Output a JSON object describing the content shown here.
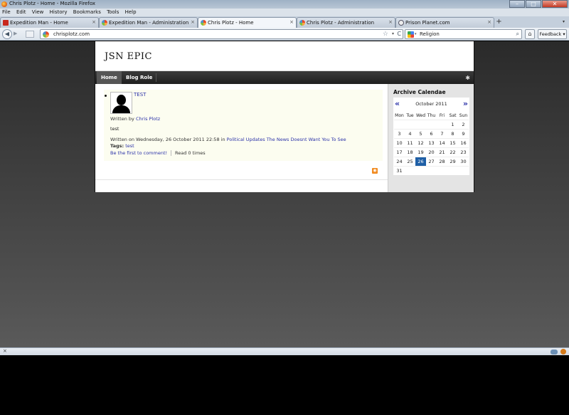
{
  "window": {
    "title": "Chris Plotz - Home - Mozilla Firefox",
    "controls": {
      "minimize": "–",
      "maximize": "□",
      "close": "✕"
    }
  },
  "menu": [
    "File",
    "Edit",
    "View",
    "History",
    "Bookmarks",
    "Tools",
    "Help"
  ],
  "tabs": [
    {
      "label": "Expedition Man - Home",
      "favicon": "red-square-icon"
    },
    {
      "label": "Expedition Man - Administration",
      "favicon": "joomla-icon"
    },
    {
      "label": "Chris Plotz - Home",
      "favicon": "site-icon",
      "active": true
    },
    {
      "label": "Chris Plotz - Administration",
      "favicon": "joomla-icon"
    },
    {
      "label": "Prison Planet.com",
      "favicon": "globe-icon"
    }
  ],
  "tab_close_glyph": "×",
  "new_tab_glyph": "+",
  "tab_list_glyph": "▾",
  "nav": {
    "url": "chrisplotz.com",
    "search_query": "Religion",
    "feedback_label": "Feedback",
    "back_glyph": "◀",
    "forward_glyph": "▶",
    "star_glyph": "☆",
    "dropdown_glyph": "▾",
    "reload_glyph": "C",
    "search_glyph": "⌕",
    "home_glyph": "⌂"
  },
  "site": {
    "logo": "JSN EPIC",
    "menu": [
      "Home",
      "Blog Role"
    ],
    "settings_glyph": "✱"
  },
  "article": {
    "title": "TEST",
    "written_by_prefix": "Written by",
    "author": "Chris Plotz",
    "body": "test",
    "meta_prefix": "Written on Wednesday, 26 October 2011 22:58 in",
    "category": "Political Updates The News Doesnt Want You To See",
    "tags_label": "Tags:",
    "tag": "test",
    "comment_link": "Be the first to comment!",
    "read_times": "Read 0 times",
    "rss_glyph": "◉"
  },
  "calendar": {
    "title": "Archive Calendae",
    "month": "October 2011",
    "prev": "«",
    "next": "»",
    "weekdays": [
      "Mon",
      "Tue",
      "Wed",
      "Thu",
      "Fri",
      "Sat",
      "Sun"
    ],
    "weeks": [
      [
        "",
        "",
        "",
        "",
        "",
        "1",
        "2"
      ],
      [
        "3",
        "4",
        "5",
        "6",
        "7",
        "8",
        "9"
      ],
      [
        "10",
        "11",
        "12",
        "13",
        "14",
        "15",
        "16"
      ],
      [
        "17",
        "18",
        "19",
        "20",
        "21",
        "22",
        "23"
      ],
      [
        "24",
        "25",
        "26",
        "27",
        "28",
        "29",
        "30"
      ],
      [
        "31",
        "",
        "",
        "",
        "",
        "",
        ""
      ]
    ],
    "today": "26"
  },
  "statusbar": {
    "close_glyph": "×"
  }
}
